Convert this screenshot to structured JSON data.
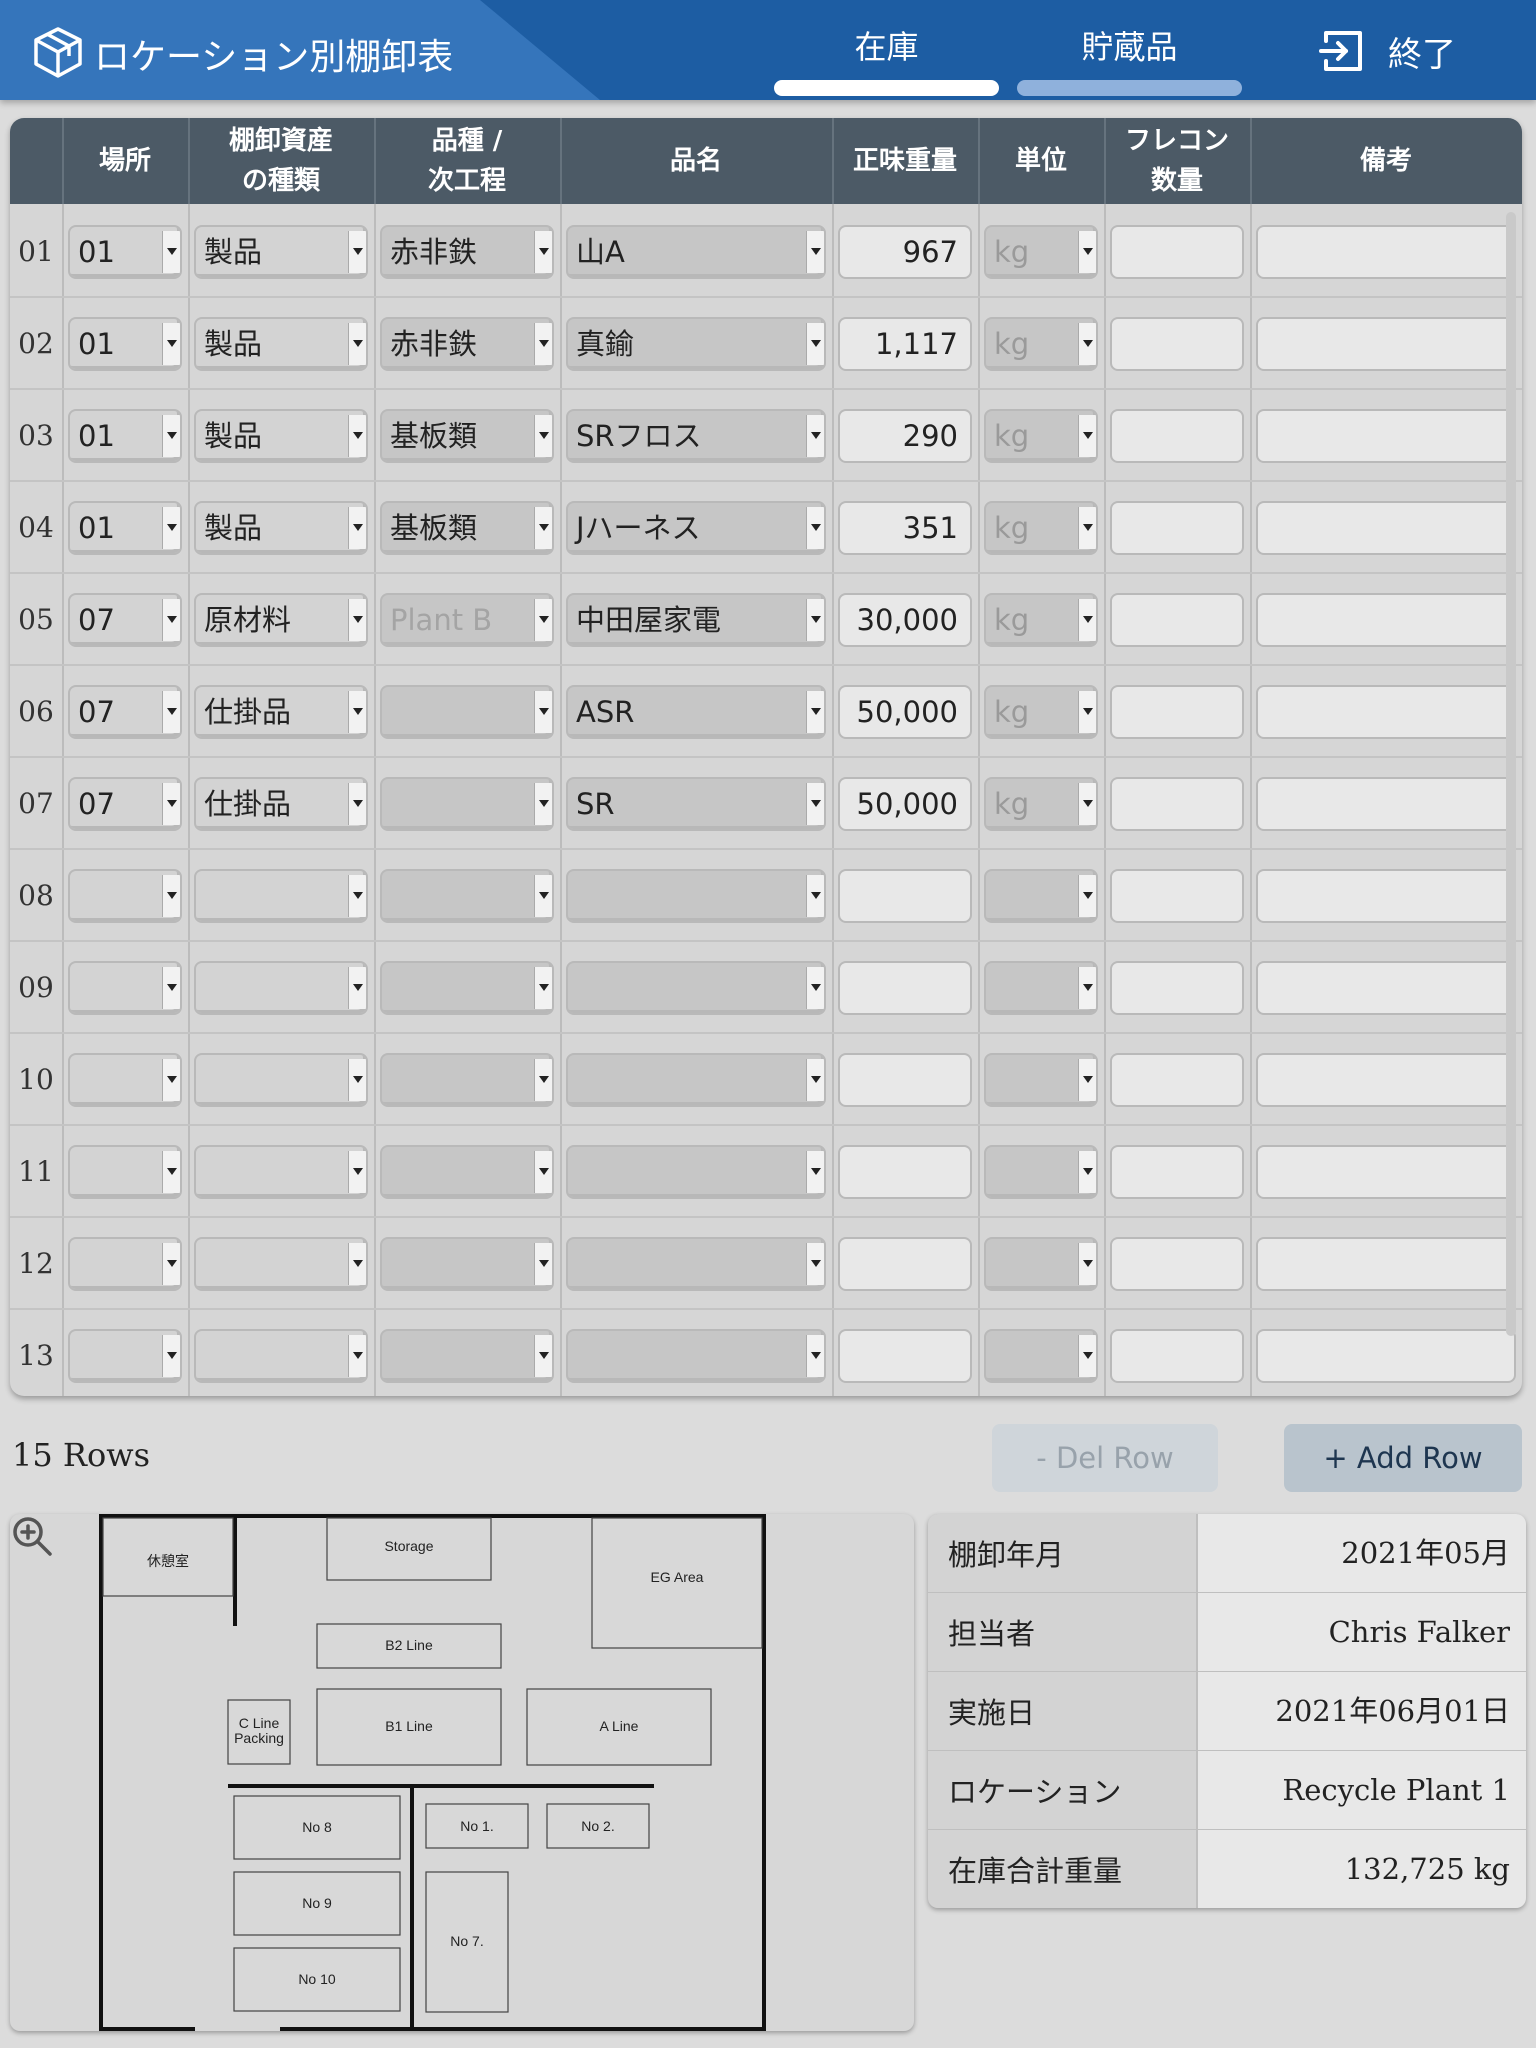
{
  "header": {
    "title": "ロケーション別棚卸表",
    "tabs": [
      {
        "label": "在庫",
        "active": true
      },
      {
        "label": "貯蔵品",
        "active": false
      }
    ],
    "exit_label": "終了"
  },
  "table": {
    "columns": [
      "",
      "場所",
      "棚卸資産\nの種類",
      "品種 /\n次工程",
      "品名",
      "正味重量",
      "単位",
      "フレコン\n数量",
      "備考"
    ],
    "rows": [
      {
        "no": "01",
        "location": "01",
        "asset_type": "製品",
        "variety": "赤非鉄",
        "item": "山A",
        "weight": "967",
        "unit": "kg",
        "bags": "",
        "note": ""
      },
      {
        "no": "02",
        "location": "01",
        "asset_type": "製品",
        "variety": "赤非鉄",
        "item": "真鍮",
        "weight": "1,117",
        "unit": "kg",
        "bags": "",
        "note": ""
      },
      {
        "no": "03",
        "location": "01",
        "asset_type": "製品",
        "variety": "基板類",
        "item": "SRフロス",
        "weight": "290",
        "unit": "kg",
        "bags": "",
        "note": ""
      },
      {
        "no": "04",
        "location": "01",
        "asset_type": "製品",
        "variety": "基板類",
        "item": "Jハーネス",
        "weight": "351",
        "unit": "kg",
        "bags": "",
        "note": ""
      },
      {
        "no": "05",
        "location": "07",
        "asset_type": "原材料",
        "variety": "Plant B",
        "item": "中田屋家電",
        "weight": "30,000",
        "unit": "kg",
        "bags": "",
        "note": ""
      },
      {
        "no": "06",
        "location": "07",
        "asset_type": "仕掛品",
        "variety": "",
        "item": "ASR",
        "weight": "50,000",
        "unit": "kg",
        "bags": "",
        "note": ""
      },
      {
        "no": "07",
        "location": "07",
        "asset_type": "仕掛品",
        "variety": "",
        "item": "SR",
        "weight": "50,000",
        "unit": "kg",
        "bags": "",
        "note": ""
      },
      {
        "no": "08",
        "location": "",
        "asset_type": "",
        "variety": "",
        "item": "",
        "weight": "",
        "unit": "",
        "bags": "",
        "note": ""
      },
      {
        "no": "09",
        "location": "",
        "asset_type": "",
        "variety": "",
        "item": "",
        "weight": "",
        "unit": "",
        "bags": "",
        "note": ""
      },
      {
        "no": "10",
        "location": "",
        "asset_type": "",
        "variety": "",
        "item": "",
        "weight": "",
        "unit": "",
        "bags": "",
        "note": ""
      },
      {
        "no": "11",
        "location": "",
        "asset_type": "",
        "variety": "",
        "item": "",
        "weight": "",
        "unit": "",
        "bags": "",
        "note": ""
      },
      {
        "no": "12",
        "location": "",
        "asset_type": "",
        "variety": "",
        "item": "",
        "weight": "",
        "unit": "",
        "bags": "",
        "note": ""
      },
      {
        "no": "13",
        "location": "",
        "asset_type": "",
        "variety": "",
        "item": "",
        "weight": "",
        "unit": "",
        "bags": "",
        "note": ""
      }
    ]
  },
  "footer": {
    "row_count": "15 Rows",
    "del_row_label": "- Del Row",
    "add_row_label": "+ Add Row"
  },
  "map": {
    "labels": {
      "rest_room": "休憩室",
      "storage": "Storage",
      "eg_area": "EG Area",
      "b2_line": "B2 Line",
      "c_line_1": "C Line",
      "c_line_2": "Packing",
      "b1_line": "B1 Line",
      "a_line": "A Line",
      "no8": "No 8",
      "no1": "No 1.",
      "no2": "No 2.",
      "no9": "No 9",
      "no7": "No 7.",
      "no10": "No 10"
    },
    "zoom_icon": "zoom-in-icon"
  },
  "info": [
    {
      "label": "棚卸年月",
      "value": "2021年05月"
    },
    {
      "label": "担当者",
      "value": "Chris Falker"
    },
    {
      "label": "実施日",
      "value": "2021年06月01日"
    },
    {
      "label": "ロケーション",
      "value": "Recycle Plant 1"
    },
    {
      "label": "在庫合計重量",
      "value": "132,725 kg"
    }
  ],
  "icons": {
    "logo": "box-icon",
    "exit": "exit-icon"
  },
  "colors": {
    "header": "#1d5da3",
    "table_header": "#4c5a66",
    "add_button": "#b9c4cd"
  }
}
